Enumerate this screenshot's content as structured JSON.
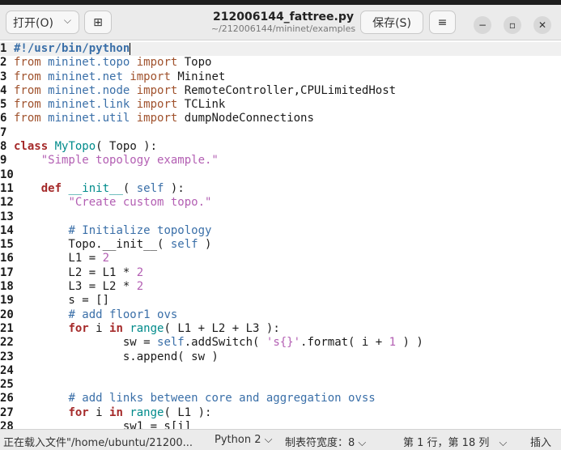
{
  "header": {
    "open_label": "打开(O)",
    "open_chevron": "⌵",
    "newtab_icon": "⊞",
    "title": "212006144_fattree.py",
    "subtitle": "~/212006144/mininet/examples",
    "save_label": "保存(S)",
    "menu_icon": "≡",
    "minimize": "−",
    "maximize": "▫",
    "close": "✕"
  },
  "editor": {
    "language": "Python",
    "lines": [
      {
        "n": "1",
        "segs": [
          {
            "c": "shebang",
            "t": "#!/usr/bin/python"
          }
        ],
        "cursor": true
      },
      {
        "n": "2",
        "segs": [
          {
            "c": "kwo",
            "t": "from"
          },
          {
            "c": "",
            "t": " "
          },
          {
            "c": "mod",
            "t": "mininet.topo"
          },
          {
            "c": "",
            "t": " "
          },
          {
            "c": "kwo",
            "t": "import"
          },
          {
            "c": "",
            "t": " Topo"
          }
        ]
      },
      {
        "n": "3",
        "segs": [
          {
            "c": "kwo",
            "t": "from"
          },
          {
            "c": "",
            "t": " "
          },
          {
            "c": "mod",
            "t": "mininet.net"
          },
          {
            "c": "",
            "t": " "
          },
          {
            "c": "kwo",
            "t": "import"
          },
          {
            "c": "",
            "t": " Mininet"
          }
        ]
      },
      {
        "n": "4",
        "segs": [
          {
            "c": "kwo",
            "t": "from"
          },
          {
            "c": "",
            "t": " "
          },
          {
            "c": "mod",
            "t": "mininet.node"
          },
          {
            "c": "",
            "t": " "
          },
          {
            "c": "kwo",
            "t": "import"
          },
          {
            "c": "",
            "t": " RemoteController,CPULimitedHost"
          }
        ]
      },
      {
        "n": "5",
        "segs": [
          {
            "c": "kwo",
            "t": "from"
          },
          {
            "c": "",
            "t": " "
          },
          {
            "c": "mod",
            "t": "mininet.link"
          },
          {
            "c": "",
            "t": " "
          },
          {
            "c": "kwo",
            "t": "import"
          },
          {
            "c": "",
            "t": " TCLink"
          }
        ]
      },
      {
        "n": "6",
        "segs": [
          {
            "c": "kwo",
            "t": "from"
          },
          {
            "c": "",
            "t": " "
          },
          {
            "c": "mod",
            "t": "mininet.util"
          },
          {
            "c": "",
            "t": " "
          },
          {
            "c": "kwo",
            "t": "import"
          },
          {
            "c": "",
            "t": " dumpNodeConnections"
          }
        ]
      },
      {
        "n": "7",
        "segs": []
      },
      {
        "n": "8",
        "segs": [
          {
            "c": "kw",
            "t": "class"
          },
          {
            "c": "",
            "t": " "
          },
          {
            "c": "fn",
            "t": "MyTopo"
          },
          {
            "c": "",
            "t": "( Topo ):"
          }
        ]
      },
      {
        "n": "9",
        "segs": [
          {
            "c": "",
            "t": "    "
          },
          {
            "c": "str",
            "t": "\"Simple topology example.\""
          }
        ]
      },
      {
        "n": "10",
        "segs": []
      },
      {
        "n": "11",
        "segs": [
          {
            "c": "",
            "t": "    "
          },
          {
            "c": "kw",
            "t": "def"
          },
          {
            "c": "",
            "t": " "
          },
          {
            "c": "fn",
            "t": "__init__"
          },
          {
            "c": "",
            "t": "( "
          },
          {
            "c": "selfc",
            "t": "self"
          },
          {
            "c": "",
            "t": " ):"
          }
        ]
      },
      {
        "n": "12",
        "segs": [
          {
            "c": "",
            "t": "        "
          },
          {
            "c": "str",
            "t": "\"Create custom topo.\""
          }
        ]
      },
      {
        "n": "13",
        "segs": []
      },
      {
        "n": "14",
        "segs": [
          {
            "c": "",
            "t": "        "
          },
          {
            "c": "cmt",
            "t": "# Initialize topology"
          }
        ]
      },
      {
        "n": "15",
        "segs": [
          {
            "c": "",
            "t": "        Topo.__init__( "
          },
          {
            "c": "selfc",
            "t": "self"
          },
          {
            "c": "",
            "t": " )"
          }
        ]
      },
      {
        "n": "16",
        "segs": [
          {
            "c": "",
            "t": "        L1 = "
          },
          {
            "c": "num",
            "t": "2"
          }
        ]
      },
      {
        "n": "17",
        "segs": [
          {
            "c": "",
            "t": "        L2 = L1 * "
          },
          {
            "c": "num",
            "t": "2"
          }
        ]
      },
      {
        "n": "18",
        "segs": [
          {
            "c": "",
            "t": "        L3 = L2 * "
          },
          {
            "c": "num",
            "t": "2"
          }
        ]
      },
      {
        "n": "19",
        "segs": [
          {
            "c": "",
            "t": "        s = []"
          }
        ]
      },
      {
        "n": "20",
        "segs": [
          {
            "c": "",
            "t": "        "
          },
          {
            "c": "cmt",
            "t": "# add floor1 ovs"
          }
        ]
      },
      {
        "n": "21",
        "segs": [
          {
            "c": "",
            "t": "        "
          },
          {
            "c": "kw",
            "t": "for"
          },
          {
            "c": "",
            "t": " i "
          },
          {
            "c": "kw",
            "t": "in"
          },
          {
            "c": "",
            "t": " "
          },
          {
            "c": "fn",
            "t": "range"
          },
          {
            "c": "",
            "t": "( L1 + L2 + L3 ):"
          }
        ]
      },
      {
        "n": "22",
        "segs": [
          {
            "c": "",
            "t": "                sw = "
          },
          {
            "c": "selfc",
            "t": "self"
          },
          {
            "c": "",
            "t": ".addSwitch( "
          },
          {
            "c": "str",
            "t": "'s{}'"
          },
          {
            "c": "",
            "t": ".format( i + "
          },
          {
            "c": "num",
            "t": "1"
          },
          {
            "c": "",
            "t": " ) )"
          }
        ]
      },
      {
        "n": "23",
        "segs": [
          {
            "c": "",
            "t": "                s.append( sw )"
          }
        ]
      },
      {
        "n": "24",
        "segs": []
      },
      {
        "n": "25",
        "segs": []
      },
      {
        "n": "26",
        "segs": [
          {
            "c": "",
            "t": "        "
          },
          {
            "c": "cmt",
            "t": "# add links between core and aggregation ovss"
          }
        ]
      },
      {
        "n": "27",
        "segs": [
          {
            "c": "",
            "t": "        "
          },
          {
            "c": "kw",
            "t": "for"
          },
          {
            "c": "",
            "t": " i "
          },
          {
            "c": "kw",
            "t": "in"
          },
          {
            "c": "",
            "t": " "
          },
          {
            "c": "fn",
            "t": "range"
          },
          {
            "c": "",
            "t": "( L1 ):"
          }
        ]
      },
      {
        "n": "28",
        "segs": [
          {
            "c": "",
            "t": "                sw1 = s[i]"
          }
        ]
      }
    ]
  },
  "status": {
    "loading_text": "正在载入文件\"/home/ubuntu/21200...",
    "language": "Python 2",
    "tab_width": "制表符宽度：8",
    "position": "第 1 行，第 18 列",
    "mode": "插入",
    "chevron": "⌵"
  }
}
